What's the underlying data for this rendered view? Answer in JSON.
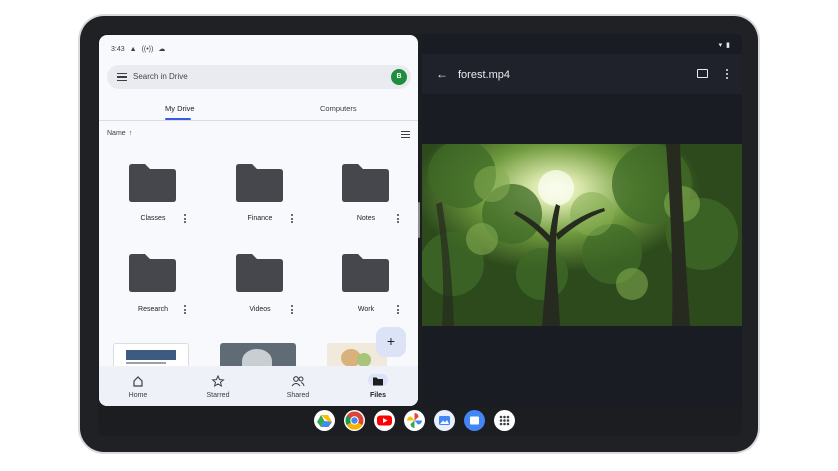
{
  "status": {
    "time": "3:43"
  },
  "drive": {
    "search_placeholder": "Search in Drive",
    "avatar_letter": "B",
    "tabs": [
      {
        "label": "My Drive"
      },
      {
        "label": "Computers"
      }
    ],
    "sort_label": "Name",
    "sort_arrow": "↑",
    "folders": [
      {
        "name": "Classes"
      },
      {
        "name": "Finance"
      },
      {
        "name": "Notes"
      },
      {
        "name": "Research"
      },
      {
        "name": "Videos"
      },
      {
        "name": "Work"
      }
    ],
    "fab_label": "+",
    "nav": [
      {
        "label": "Home",
        "icon": "home-icon"
      },
      {
        "label": "Starred",
        "icon": "star-icon"
      },
      {
        "label": "Shared",
        "icon": "people-icon"
      },
      {
        "label": "Files",
        "icon": "folder-icon"
      }
    ],
    "active_nav": "Files"
  },
  "video": {
    "title": "forest.mp4"
  },
  "dock": {
    "apps": [
      "drive-icon",
      "chrome-icon",
      "youtube-icon",
      "photos-icon",
      "gallery-icon",
      "files-app-icon",
      "app-launcher-icon"
    ]
  },
  "colors": {
    "accent": "#3b5bdb",
    "folder": "#45474c",
    "drive_bg": "#f8f9fc",
    "video_bg": "#1a1c24"
  }
}
